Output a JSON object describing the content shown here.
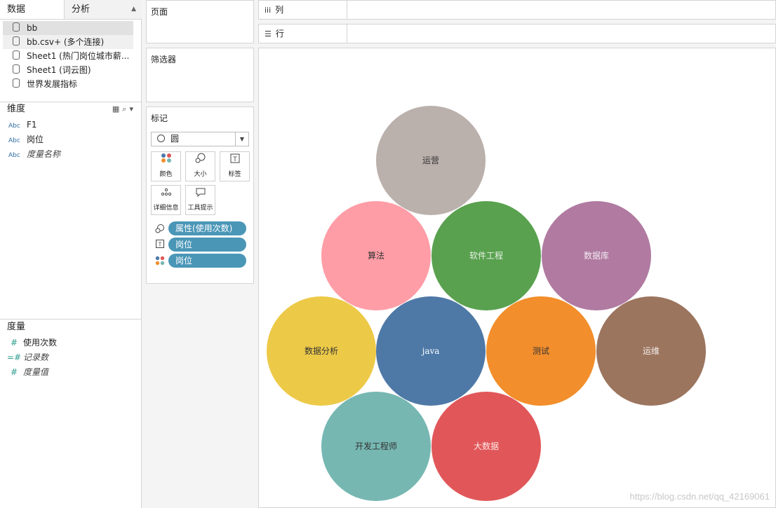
{
  "tabs": {
    "data": "数据",
    "analysis": "分析"
  },
  "datasources": [
    "bb",
    "bb.csv+ (多个连接)",
    "Sheet1 (热门岗位城市薪...",
    "Sheet1 (词云图)",
    "世界发展指标"
  ],
  "dimensions": {
    "title": "维度",
    "fields": [
      {
        "type": "Abc",
        "label": "F1",
        "italic": false
      },
      {
        "type": "Abc",
        "label": "岗位",
        "italic": false
      },
      {
        "type": "Abc",
        "label": "度量名称",
        "italic": true
      }
    ]
  },
  "measures": {
    "title": "度量",
    "fields": [
      {
        "type": "#",
        "label": "使用次数",
        "italic": false
      },
      {
        "type": "=#",
        "label": "记录数",
        "italic": true
      },
      {
        "type": "#",
        "label": "度量值",
        "italic": true
      }
    ]
  },
  "pages_title": "页面",
  "filters_title": "筛选器",
  "marks": {
    "title": "标记",
    "mark_type": "圆",
    "buttons": {
      "color": "颜色",
      "size": "大小",
      "label": "标签",
      "detail": "详细信息",
      "tooltip": "工具提示"
    },
    "pills": [
      {
        "icon": "size-icon",
        "label": "属性(使用次数)"
      },
      {
        "icon": "label-icon",
        "label": "岗位"
      },
      {
        "icon": "color-icon",
        "label": "岗位"
      }
    ]
  },
  "shelves": {
    "columns": "列",
    "rows": "行"
  },
  "bubbles": [
    {
      "label": "运营",
      "color": "#bab0ac",
      "text_color": "#333333"
    },
    {
      "label": "算法",
      "color": "#ff9da7",
      "text_color": "#333333"
    },
    {
      "label": "软件工程",
      "color": "#59a14f",
      "text_color": "#e8f2e6"
    },
    {
      "label": "数据库",
      "color": "#b07aa1",
      "text_color": "#f3e9f1"
    },
    {
      "label": "数据分析",
      "color": "#edc948",
      "text_color": "#333333"
    },
    {
      "label": "java",
      "color": "#4e79a7",
      "text_color": "#ffffff"
    },
    {
      "label": "测试",
      "color": "#f28e2b",
      "text_color": "#333333"
    },
    {
      "label": "运维",
      "color": "#9c755f",
      "text_color": "#f2ece8"
    },
    {
      "label": "开发工程师",
      "color": "#76b7b2",
      "text_color": "#333333"
    },
    {
      "label": "大数据",
      "color": "#e15759",
      "text_color": "#fde8e8"
    }
  ],
  "watermark": "https://blog.csdn.net/qq_42169061"
}
